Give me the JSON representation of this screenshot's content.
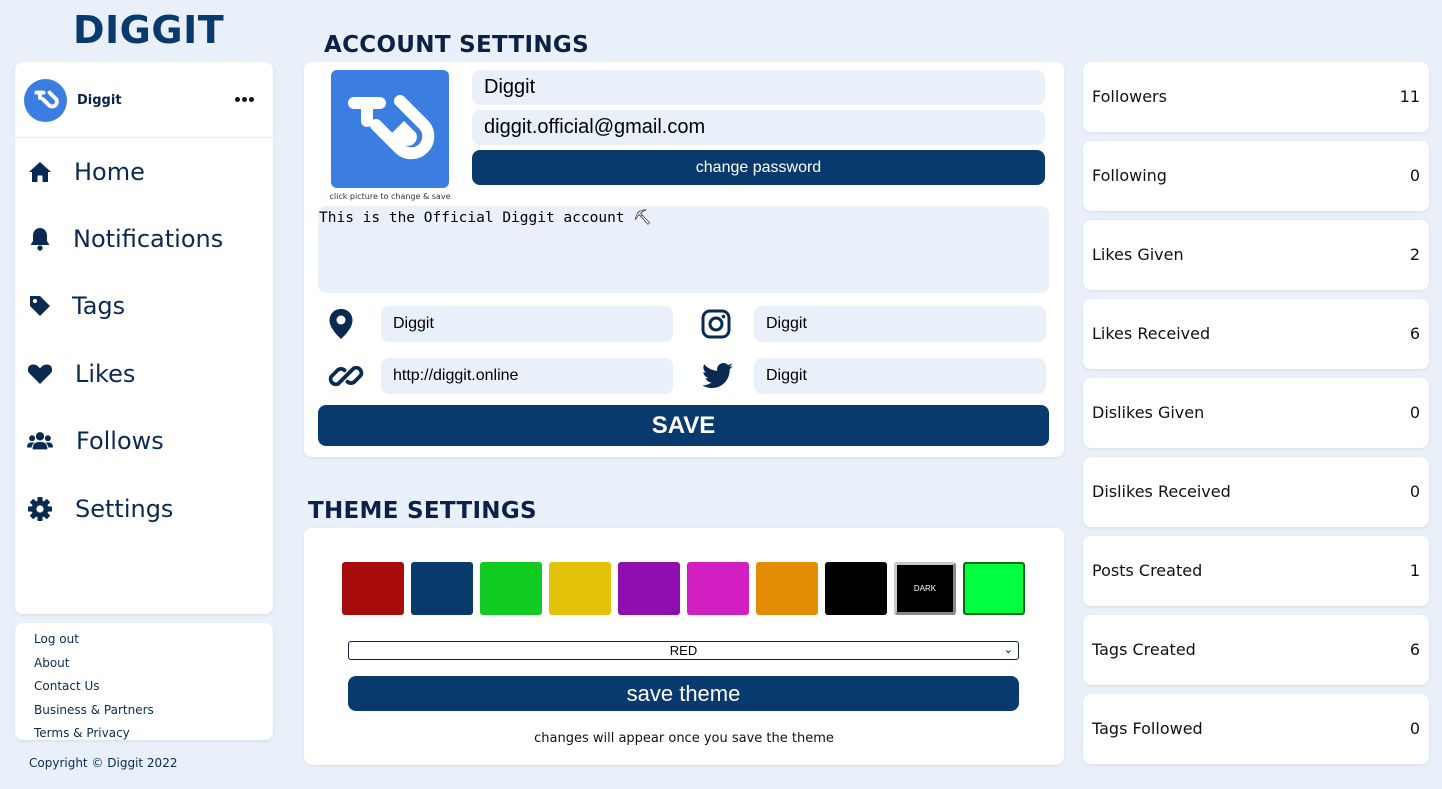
{
  "brand": "DIGGIT",
  "profile": {
    "name": "Diggit"
  },
  "nav": [
    {
      "label": "Home",
      "icon": "home-icon"
    },
    {
      "label": "Notifications",
      "icon": "bell-icon"
    },
    {
      "label": "Tags",
      "icon": "tag-icon"
    },
    {
      "label": "Likes",
      "icon": "heart-icon"
    },
    {
      "label": "Follows",
      "icon": "users-icon"
    },
    {
      "label": "Settings",
      "icon": "gear-icon"
    }
  ],
  "footer_links": [
    "Log out",
    "About",
    "Contact Us",
    "Business & Partners",
    "Terms & Privacy"
  ],
  "copyright": "Copyright © Diggit 2022",
  "account": {
    "title": "ACCOUNT SETTINGS",
    "picture_hint": "click picture to change & save",
    "username": "Diggit",
    "email": "diggit.official@gmail.com",
    "change_password_label": "change password",
    "bio": "This is the Official Diggit account ⛏",
    "location": "Diggit",
    "instagram": "Diggit",
    "website": "http://diggit.online",
    "twitter": "Diggit",
    "save_label": "SAVE"
  },
  "theme": {
    "title": "THEME SETTINGS",
    "swatches": [
      {
        "name": "red",
        "color": "#a80b0b"
      },
      {
        "name": "navy",
        "color": "#083a6e"
      },
      {
        "name": "green",
        "color": "#12cc24"
      },
      {
        "name": "yellow",
        "color": "#e3c20a"
      },
      {
        "name": "purple",
        "color": "#8f0eb0"
      },
      {
        "name": "magenta",
        "color": "#d11fc1"
      },
      {
        "name": "orange",
        "color": "#e58c07"
      },
      {
        "name": "black",
        "color": "#000000"
      },
      {
        "name": "dark",
        "color": "#000000",
        "label": "DARK"
      },
      {
        "name": "neon-green",
        "color": "#00ff40"
      }
    ],
    "selected": "RED",
    "save_label": "save theme",
    "note": "changes will appear once you save the theme"
  },
  "stats": [
    {
      "label": "Followers",
      "value": "11"
    },
    {
      "label": "Following",
      "value": "0"
    },
    {
      "label": "Likes Given",
      "value": "2"
    },
    {
      "label": "Likes Received",
      "value": "6"
    },
    {
      "label": "Dislikes Given",
      "value": "0"
    },
    {
      "label": "Dislikes Received",
      "value": "0"
    },
    {
      "label": "Posts Created",
      "value": "1"
    },
    {
      "label": "Tags Created",
      "value": "6"
    },
    {
      "label": "Tags Followed",
      "value": "0"
    }
  ],
  "colors": {
    "accent": "#083a6e",
    "logo_blue": "#3b7de1",
    "background": "#e9f0fa"
  }
}
